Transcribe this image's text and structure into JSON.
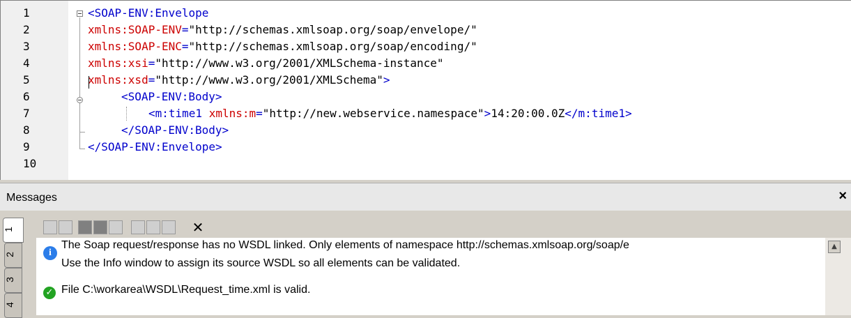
{
  "editor": {
    "line_numbers": [
      "1",
      "2",
      "3",
      "4",
      "5",
      "6",
      "7",
      "8",
      "9",
      "10"
    ],
    "lines": [
      {
        "p1": "<SOAP-ENV:Envelope"
      },
      {
        "attr": "xmlns:SOAP-ENV",
        "eq": "=",
        "val": "\"http://schemas.xmlsoap.org/soap/envelope/\""
      },
      {
        "attr": "xmlns:SOAP-ENC",
        "eq": "=",
        "val": "\"http://schemas.xmlsoap.org/soap/encoding/\""
      },
      {
        "attr": "xmlns:xsi",
        "eq": "=",
        "val": "\"http://www.w3.org/2001/XMLSchema-instance\""
      },
      {
        "attr": "xmlns:xsd",
        "eq": "=",
        "val": "\"http://www.w3.org/2001/XMLSchema\"",
        "end": ">"
      },
      {
        "p1": "<SOAP-ENV:Body>"
      },
      {
        "open": "<m:time1 ",
        "attr": "xmlns:m",
        "eq": "=",
        "val": "\"http://new.webservice.namespace\"",
        "close": ">",
        "text": "14:20:00.0Z",
        "endtag": "</m:time1>"
      },
      {
        "p1": "</SOAP-ENV:Body>"
      },
      {
        "p1": "</SOAP-ENV:Envelope>"
      }
    ]
  },
  "messages": {
    "title": "Messages",
    "close": "×",
    "tabs": [
      "1",
      "2",
      "3",
      "4"
    ],
    "toolbar_close": "✕",
    "items": [
      {
        "icon": "info",
        "line1": "The Soap request/response has no WSDL linked. Only elements of namespace http://schemas.xmlsoap.org/soap/e",
        "line2": "Use the Info window to assign its source WSDL so all elements can be validated."
      },
      {
        "icon": "ok",
        "line1": "File C:\\workarea\\WSDL\\Request_time.xml is valid."
      }
    ],
    "scroll_up": "▲"
  }
}
